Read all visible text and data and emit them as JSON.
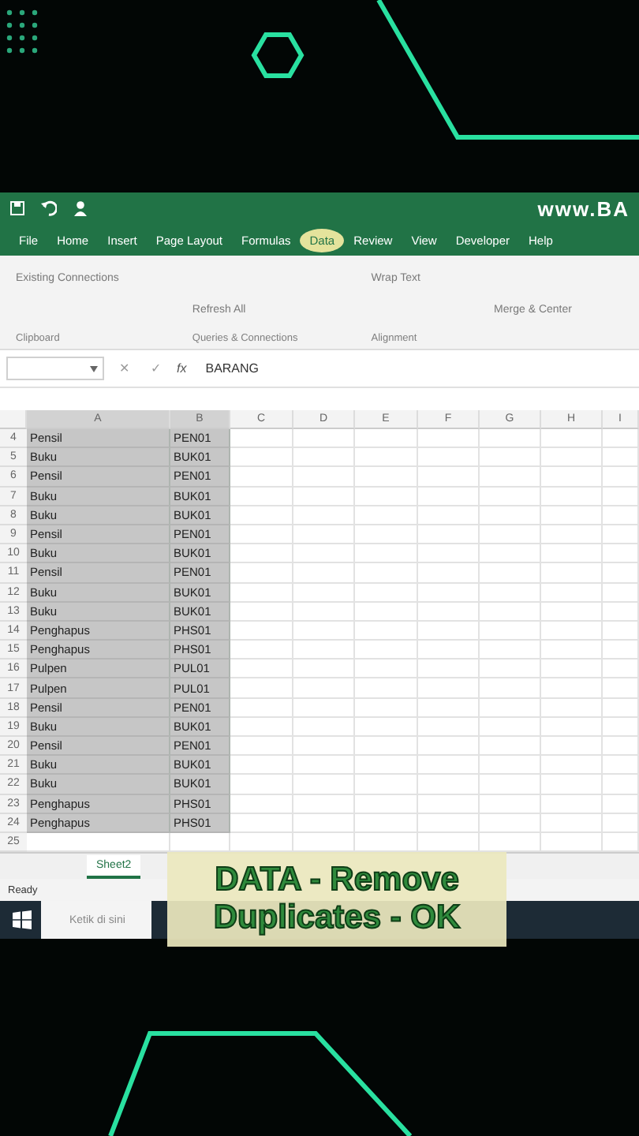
{
  "title_bar": {
    "site": "www.BA"
  },
  "ribbon_tabs": [
    {
      "label": "File",
      "selected": false
    },
    {
      "label": "Home",
      "selected": false
    },
    {
      "label": "Insert",
      "selected": false
    },
    {
      "label": "Page Layout",
      "selected": false
    },
    {
      "label": "Formulas",
      "selected": false
    },
    {
      "label": "Data",
      "selected": true
    },
    {
      "label": "Review",
      "selected": false
    },
    {
      "label": "View",
      "selected": false
    },
    {
      "label": "Developer",
      "selected": false
    },
    {
      "label": "Help",
      "selected": false
    }
  ],
  "ribbon": {
    "items": [
      "Existing Connections",
      "Refresh All",
      "Wrap Text",
      "Merge & Center"
    ],
    "groups": [
      "Clipboard",
      "Queries & Connections",
      "Alignment"
    ]
  },
  "formula_bar": {
    "cancel": "✕",
    "enter": "✓",
    "fx": "fx",
    "value": "BARANG"
  },
  "columns": [
    "A",
    "B",
    "C",
    "D",
    "E",
    "F",
    "G",
    "H",
    "I"
  ],
  "rows": [
    {
      "num": "4",
      "a": "Pensil",
      "b": "PEN01",
      "selected": true
    },
    {
      "num": "5",
      "a": "Buku",
      "b": "BUK01",
      "selected": true
    },
    {
      "num": "6",
      "a": "Pensil",
      "b": "PEN01",
      "selected": true
    },
    {
      "num": "7",
      "a": "Buku",
      "b": "BUK01",
      "selected": true
    },
    {
      "num": "8",
      "a": "Buku",
      "b": "BUK01",
      "selected": true
    },
    {
      "num": "9",
      "a": "Pensil",
      "b": "PEN01",
      "selected": true
    },
    {
      "num": "10",
      "a": "Buku",
      "b": "BUK01",
      "selected": true
    },
    {
      "num": "11",
      "a": "Pensil",
      "b": "PEN01",
      "selected": true
    },
    {
      "num": "12",
      "a": "Buku",
      "b": "BUK01",
      "selected": true
    },
    {
      "num": "13",
      "a": "Buku",
      "b": "BUK01",
      "selected": true
    },
    {
      "num": "14",
      "a": "Penghapus",
      "b": "PHS01",
      "selected": true
    },
    {
      "num": "15",
      "a": "Penghapus",
      "b": "PHS01",
      "selected": true
    },
    {
      "num": "16",
      "a": "Pulpen",
      "b": "PUL01",
      "selected": true
    },
    {
      "num": "17",
      "a": "Pulpen",
      "b": "PUL01",
      "selected": true
    },
    {
      "num": "18",
      "a": "Pensil",
      "b": "PEN01",
      "selected": true
    },
    {
      "num": "19",
      "a": "Buku",
      "b": "BUK01",
      "selected": true
    },
    {
      "num": "20",
      "a": "Pensil",
      "b": "PEN01",
      "selected": true
    },
    {
      "num": "21",
      "a": "Buku",
      "b": "BUK01",
      "selected": true
    },
    {
      "num": "22",
      "a": "Buku",
      "b": "BUK01",
      "selected": true
    },
    {
      "num": "23",
      "a": "Penghapus",
      "b": "PHS01",
      "selected": true
    },
    {
      "num": "24",
      "a": "Penghapus",
      "b": "PHS01",
      "selected": true
    },
    {
      "num": "25",
      "selected": false
    }
  ],
  "sheet_tabs": [
    {
      "label": "Sheet2",
      "selected": true
    }
  ],
  "status_bar": {
    "text": "Ready"
  },
  "taskbar": {
    "search_placeholder": "Ketik di sini"
  },
  "caption": {
    "lines": [
      "DATA - Remove",
      "Duplicates - OK"
    ]
  }
}
